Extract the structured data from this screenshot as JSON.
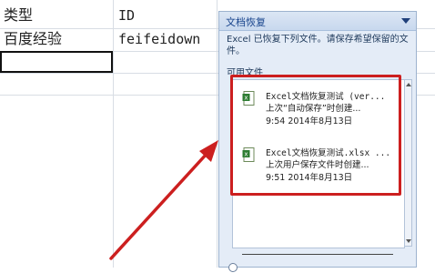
{
  "sheet": {
    "row1": {
      "col_a": "类型",
      "col_b": "ID"
    },
    "row2": {
      "col_a": "百度经验",
      "col_b": "feifeidown"
    }
  },
  "recovery_pane": {
    "title": "文档恢复",
    "description": "Excel 已恢复下列文件。请保存希望保留的文件。",
    "section_label": "可用文件",
    "files": [
      {
        "name": "Excel文档恢复测试 (ver...",
        "note": "上次“自动保存”时创建...",
        "time": "9:54 2014年8月13日",
        "icon": "excel-file-icon"
      },
      {
        "name": "Excel文档恢复测试.xlsx ...",
        "note": "上次用户保存文件时创建...",
        "time": "9:51 2014年8月13日",
        "icon": "excel-file-icon"
      }
    ]
  },
  "colors": {
    "annotation_red": "#cc1f1f",
    "pane_bg": "#e4ecf7",
    "pane_title": "#15428b"
  }
}
